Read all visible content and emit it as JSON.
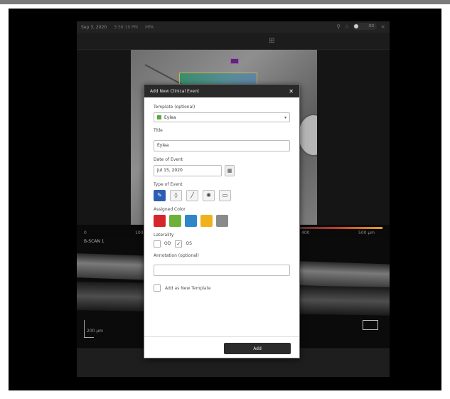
{
  "app": {
    "date": "Sep 3, 2020",
    "time": "3:56:10 PM",
    "mode": "MFA",
    "eye_toggle": "OD"
  },
  "viewer": {
    "scale_start": "0",
    "scale_mid": "100",
    "scale_right": "400",
    "scale_max": "500 µm",
    "oct_label": "B-SCAN 1",
    "oct_scale": "200 µm"
  },
  "dialog": {
    "title": "Add New Clinical Event",
    "template_label": "Template (optional)",
    "template_value": "Eylea",
    "title_label": "Title",
    "title_value": "Eylea",
    "date_label": "Date of Event",
    "date_value": "Jul 15, 2020",
    "type_label": "Type of Event",
    "color_label": "Assigned Color",
    "colors": [
      "#d6262b",
      "#6cb23a",
      "#2f86c8",
      "#f0b21c",
      "#8a8a8a"
    ],
    "laterality_label": "Laterality",
    "lat_od": "OD",
    "lat_os": "OS",
    "annotation_label": "Annotation (optional)",
    "annotation_value": "",
    "template_checkbox": "Add as New Template",
    "add_button": "Add"
  }
}
